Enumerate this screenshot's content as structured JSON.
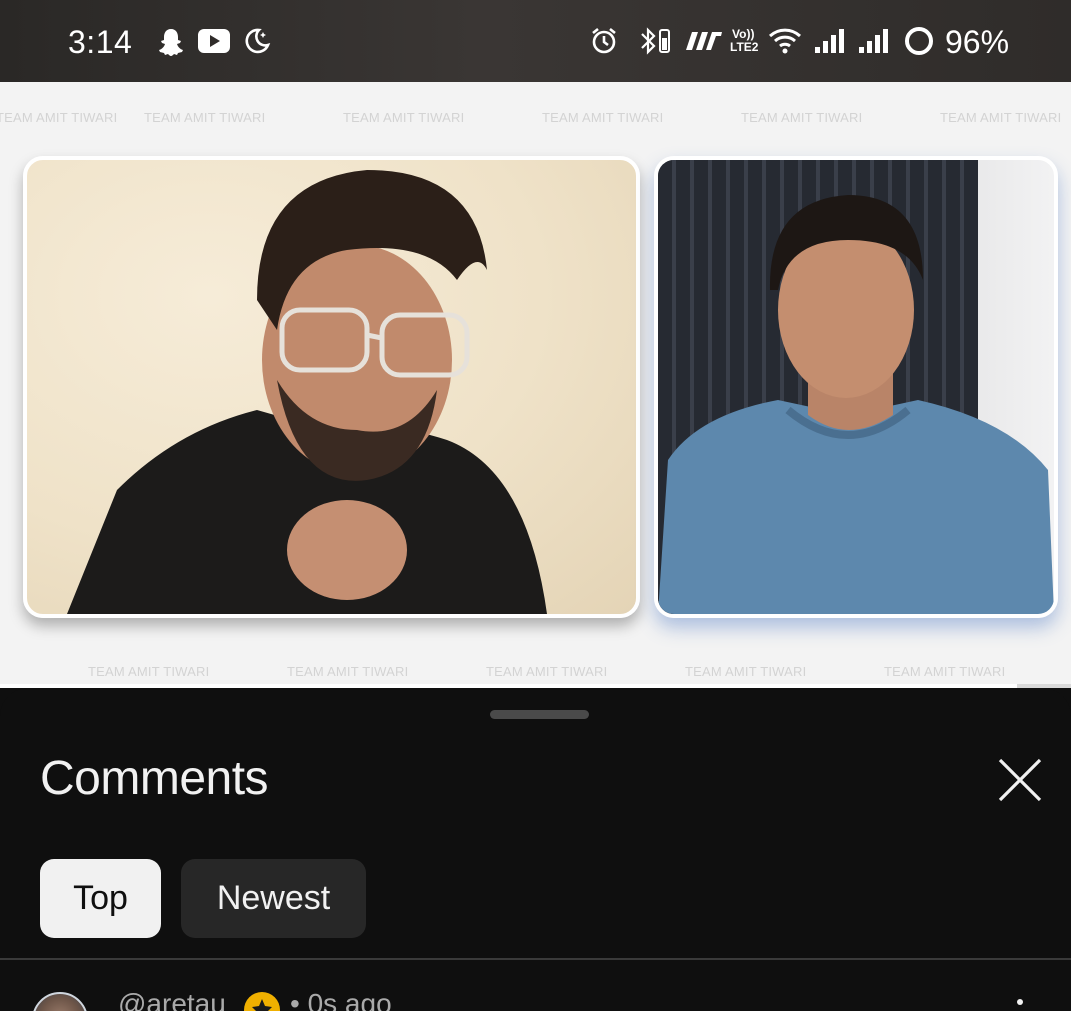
{
  "status_bar": {
    "time": "3:14",
    "app_icons": [
      "snapchat-icon",
      "youtube-icon",
      "do-not-disturb-icon"
    ],
    "system_icons": [
      "alarm-icon",
      "bluetooth-battery-icon",
      "carrier-logo-icon",
      "volte-lte2-icon",
      "wifi-icon",
      "signal-sim1-icon",
      "signal-sim2-icon",
      "battery-ring-icon"
    ],
    "network_label_1": "Vo))",
    "network_label_2": "LTE2",
    "battery_text": "96%"
  },
  "video": {
    "watermark_text": "TEAM AMIT TIWARI",
    "progress_fraction": 0.95,
    "participants": [
      "left-participant-video",
      "right-participant-video"
    ]
  },
  "comments": {
    "title": "Comments",
    "close_icon": "close-icon",
    "sort_chips": [
      {
        "label": "Top",
        "selected": true
      },
      {
        "label": "Newest",
        "selected": false
      }
    ],
    "first_comment": {
      "author": "@aretau",
      "meta": "• 0s ago"
    }
  },
  "colors": {
    "sheet_background": "#0f0f0f",
    "chip_selected": "#f1f1f1",
    "chip_unselected": "#272727",
    "text_primary": "#f1f1f1",
    "text_secondary": "#aaaaaa"
  }
}
